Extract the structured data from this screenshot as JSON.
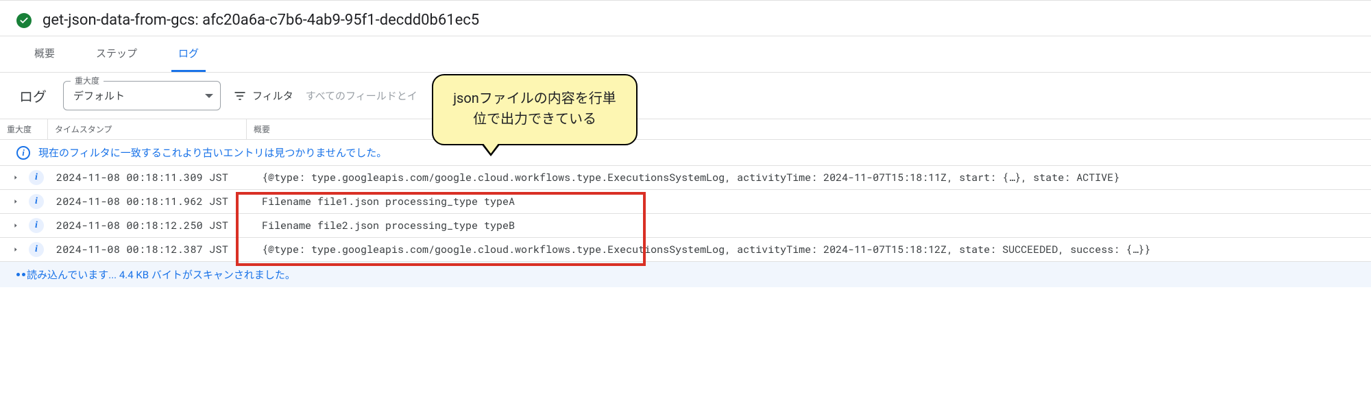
{
  "header": {
    "title": "get-json-data-from-gcs: afc20a6a-c7b6-4ab9-95f1-decdd0b61ec5"
  },
  "tabs": {
    "overview": "概要",
    "steps": "ステップ",
    "logs": "ログ",
    "active": "logs"
  },
  "controls": {
    "label": "ログ",
    "severity_legend": "重大度",
    "severity_value": "デフォルト",
    "filter_label": "フィルタ",
    "filter_placeholder": "すべてのフィールドとイ"
  },
  "columns": {
    "severity": "重大度",
    "timestamp": "タイムスタンプ",
    "summary": "概要"
  },
  "info_row": "現在のフィルタに一致するこれより古いエントリは見つかりませんでした。",
  "log_rows": [
    {
      "timestamp": "2024-11-08 00:18:11.309 JST",
      "summary": "{@type: type.googleapis.com/google.cloud.workflows.type.ExecutionsSystemLog, activityTime: 2024-11-07T15:18:11Z, start: {…}, state: ACTIVE}"
    },
    {
      "timestamp": "2024-11-08 00:18:11.962 JST",
      "summary": "Filename file1.json processing_type typeA"
    },
    {
      "timestamp": "2024-11-08 00:18:12.250 JST",
      "summary": "Filename file2.json processing_type typeB"
    },
    {
      "timestamp": "2024-11-08 00:18:12.387 JST",
      "summary": "{@type: type.googleapis.com/google.cloud.workflows.type.ExecutionsSystemLog, activityTime: 2024-11-07T15:18:12Z, state: SUCCEEDED, success: {…}}"
    }
  ],
  "loading": {
    "text_prefix": "読み込んでいます... ",
    "size": "4.4 KB",
    "text_suffix": " バイトがスキャンされました。"
  },
  "callout": "jsonファイルの内容を行単位で出力できている"
}
